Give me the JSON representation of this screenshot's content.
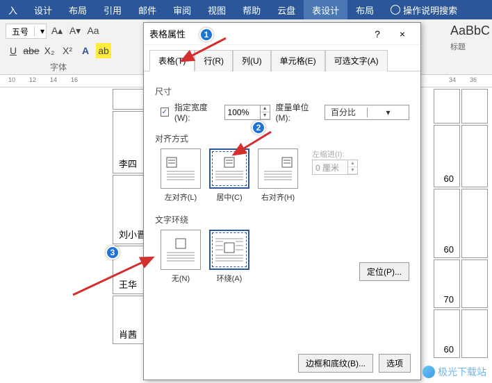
{
  "ribbon": {
    "tabs": [
      "入",
      "设计",
      "布局",
      "引用",
      "邮件",
      "审阅",
      "视图",
      "帮助",
      "云盘",
      "表设计",
      "布局"
    ],
    "active_tab_index": 9,
    "tell_me": "操作说明搜索"
  },
  "font_group": {
    "size": "五号",
    "underline": "U",
    "strike": "abe",
    "subscript": "X₂",
    "superscript": "X²",
    "text_effect_A": "A",
    "highlight": "ab",
    "label": "字体"
  },
  "styles": {
    "sample": "AaBbC",
    "name": "标题"
  },
  "ruler": {
    "ticks_left": [
      "10",
      "12",
      "14",
      "16"
    ],
    "ticks_right": [
      "34",
      "36"
    ]
  },
  "doc_rows": [
    "李四",
    "刘小晋",
    "王华",
    "肖茜"
  ],
  "col_values": [
    "60",
    "60",
    "70",
    "60"
  ],
  "dialog": {
    "title": "表格属性",
    "help": "?",
    "close": "×",
    "tabs": {
      "table": "表格(T)",
      "row": "行(R)",
      "column": "列(U)",
      "cell": "单元格(E)",
      "alt": "可选文字(A)"
    },
    "size": {
      "label": "尺寸",
      "specify_width": "指定宽度(W):",
      "width_value": "100%",
      "unit_label": "度量单位(M):",
      "unit_value": "百分比"
    },
    "align": {
      "label": "对齐方式",
      "left": "左对齐(L)",
      "center": "居中(C)",
      "right": "右对齐(H)",
      "indent_label": "左缩进(I):",
      "indent_value": "0 厘米"
    },
    "wrap": {
      "label": "文字环绕",
      "none": "无(N)",
      "around": "环绕(A)",
      "position_btn": "定位(P)..."
    },
    "footer": {
      "borders": "边框和底纹(B)...",
      "options": "选项"
    }
  },
  "watermark": "极光下载站",
  "badges": {
    "b1": "1",
    "b2": "2",
    "b3": "3"
  }
}
